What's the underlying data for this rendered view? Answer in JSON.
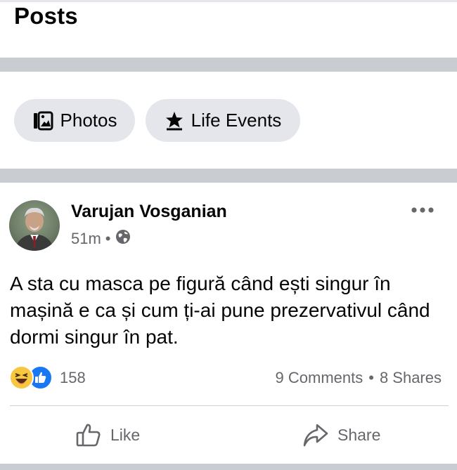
{
  "section": {
    "title": "Posts"
  },
  "filters": {
    "photos_label": "Photos",
    "life_events_label": "Life Events"
  },
  "post": {
    "author": "Varujan Vosganian",
    "time": "51m",
    "text": "A sta cu masca pe figură când ești singur în mașină e ca și cum ți-ai pune prezervativul când dormi singur în pat.",
    "reactions_count": "158",
    "comments": "9 Comments",
    "shares": "8 Shares",
    "like_label": "Like",
    "share_label": "Share"
  },
  "colors": {
    "divider": "#c9ccd1",
    "pill": "#e4e6eb",
    "secondary_text": "#65676b",
    "like_blue": "#1877f2",
    "haha_yellow": "#f7c740"
  }
}
